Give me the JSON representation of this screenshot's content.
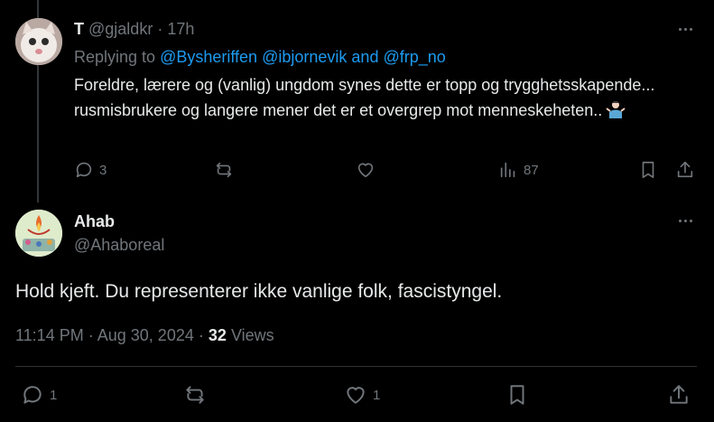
{
  "parent_tweet": {
    "display_name": "T",
    "handle": "@gjaldkr",
    "separator": "·",
    "time": "17h",
    "replying_prefix": "Replying to",
    "replying_mentions": [
      "@Bysheriffen",
      "@ibjornevik",
      "@frp_no"
    ],
    "replying_and": "and",
    "text": "Foreldre, lærere og (vanlig) ungdom synes dette er topp og trygghetsskapende... rusmisbrukere og langere mener det er et overgrep mot menneskeheten..",
    "emoji_icon": "person-shrugging-emoji",
    "actions": {
      "replies": "3",
      "reposts": "",
      "likes": "",
      "views": "87"
    }
  },
  "main_tweet": {
    "display_name": "Ahab",
    "handle": "@Ahaboreal",
    "text": "Hold kjeft. Du representerer ikke vanlige folk, fascistyngel.",
    "time": "11:14 PM",
    "dot1": "·",
    "date": "Aug 30, 2024",
    "dot2": "·",
    "views_count": "32",
    "views_label": "Views",
    "actions": {
      "replies": "1",
      "reposts": "",
      "likes": "1"
    }
  },
  "colors": {
    "background": "#000000",
    "text_primary": "#e7e9ea",
    "text_muted": "#71767b",
    "link": "#1d9bf0",
    "divider": "#2f3336"
  }
}
